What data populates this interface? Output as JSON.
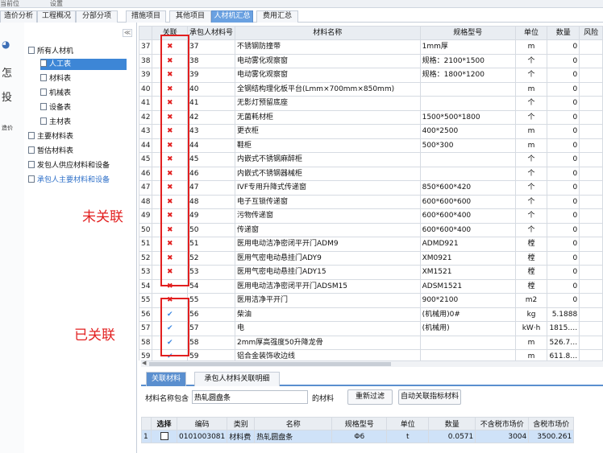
{
  "topbar": {
    "left": "当前位",
    "middle": "设置"
  },
  "tabs": [
    {
      "label": "造价分析",
      "active": false
    },
    {
      "label": "工程概况",
      "active": false
    },
    {
      "label": "分部分项",
      "active": false
    },
    {
      "label": "措施项目",
      "active": false
    },
    {
      "label": "其他项目",
      "active": false
    },
    {
      "label": "人材机汇总",
      "active": true
    },
    {
      "label": "费用汇总",
      "active": false
    }
  ],
  "left_strip": {
    "text1": "怎",
    "text2": "投",
    "text3": "造价"
  },
  "tree": {
    "collapse": "≪",
    "items": [
      {
        "label": "所有人材机",
        "level": 0,
        "selected": false
      },
      {
        "label": "人工表",
        "level": 1,
        "selected": true
      },
      {
        "label": "材料表",
        "level": 1,
        "selected": false
      },
      {
        "label": "机械表",
        "level": 1,
        "selected": false
      },
      {
        "label": "设备表",
        "level": 1,
        "selected": false
      },
      {
        "label": "主材表",
        "level": 1,
        "selected": false
      },
      {
        "label": "主要材料表",
        "level": 0,
        "selected": false
      },
      {
        "label": "暂估材料表",
        "level": 0,
        "selected": false
      },
      {
        "label": "发包人供应材料和设备",
        "level": 0,
        "selected": false
      },
      {
        "label": "承包人主要材料和设备",
        "level": 0,
        "selected": false,
        "blue": true
      }
    ]
  },
  "grid": {
    "headers": [
      "",
      "关联",
      "承包人材料号",
      "材料名称",
      "规格型号",
      "单位",
      "数量",
      "风险"
    ],
    "rows": [
      {
        "seq": "37",
        "linked": false,
        "no": "37",
        "name": "不锈钢防撞带",
        "spec": "1mm厚",
        "unit": "m",
        "qty": "0"
      },
      {
        "seq": "38",
        "linked": false,
        "no": "38",
        "name": "电动雾化观察窗",
        "spec": "规格：2100*1500",
        "unit": "个",
        "qty": "0"
      },
      {
        "seq": "39",
        "linked": false,
        "no": "39",
        "name": "电动雾化观察窗",
        "spec": "规格：1800*1200",
        "unit": "个",
        "qty": "0"
      },
      {
        "seq": "40",
        "linked": false,
        "no": "40",
        "name": "全钢结构理化板平台(Lmm×700mm×850mm)",
        "spec": "",
        "unit": "m",
        "qty": "0"
      },
      {
        "seq": "41",
        "linked": false,
        "no": "41",
        "name": "无影灯预留底座",
        "spec": "",
        "unit": "个",
        "qty": "0"
      },
      {
        "seq": "42",
        "linked": false,
        "no": "42",
        "name": "无菌耗材柜",
        "spec": "1500*500*1800",
        "unit": "个",
        "qty": "0"
      },
      {
        "seq": "43",
        "linked": false,
        "no": "43",
        "name": "更衣柜",
        "spec": "400*2500",
        "unit": "m",
        "qty": "0"
      },
      {
        "seq": "44",
        "linked": false,
        "no": "44",
        "name": "鞋柜",
        "spec": "500*300",
        "unit": "m",
        "qty": "0"
      },
      {
        "seq": "45",
        "linked": false,
        "no": "45",
        "name": "内嵌式不锈钢麻醉柜",
        "spec": "",
        "unit": "个",
        "qty": "0"
      },
      {
        "seq": "46",
        "linked": false,
        "no": "46",
        "name": "内嵌式不锈钢器械柜",
        "spec": "",
        "unit": "个",
        "qty": "0"
      },
      {
        "seq": "47",
        "linked": false,
        "no": "47",
        "name": "IVF专用升降式传递窗",
        "spec": "850*600*420",
        "unit": "个",
        "qty": "0"
      },
      {
        "seq": "48",
        "linked": false,
        "no": "48",
        "name": "电子互锁传递窗",
        "spec": "600*600*600",
        "unit": "个",
        "qty": "0"
      },
      {
        "seq": "49",
        "linked": false,
        "no": "49",
        "name": "污物传递窗",
        "spec": "600*600*400",
        "unit": "个",
        "qty": "0"
      },
      {
        "seq": "50",
        "linked": false,
        "no": "50",
        "name": "传递窗",
        "spec": "600*600*400",
        "unit": "个",
        "qty": "0"
      },
      {
        "seq": "51",
        "linked": false,
        "no": "51",
        "name": "医用电动洁净密闭平开门ADM9",
        "spec": "ADMD921",
        "unit": "樘",
        "qty": "0"
      },
      {
        "seq": "52",
        "linked": false,
        "no": "52",
        "name": "医用气密电动悬挂门ADY9",
        "spec": "XM0921",
        "unit": "樘",
        "qty": "0"
      },
      {
        "seq": "53",
        "linked": false,
        "no": "53",
        "name": "医用气密电动悬挂门ADY15",
        "spec": "XM1521",
        "unit": "樘",
        "qty": "0"
      },
      {
        "seq": "54",
        "linked": false,
        "no": "54",
        "name": "医用电动洁净密闭平开门ADSM15",
        "spec": "ADSM1521",
        "unit": "樘",
        "qty": "0"
      },
      {
        "seq": "55",
        "linked": false,
        "no": "55",
        "name": "医用洁净平开门",
        "spec": "900*2100",
        "unit": "m2",
        "qty": "0"
      },
      {
        "seq": "56",
        "linked": true,
        "no": "56",
        "name": "柴油",
        "spec": "(机械用)0#",
        "unit": "kg",
        "qty": "5.1888"
      },
      {
        "seq": "57",
        "linked": true,
        "no": "57",
        "name": "电",
        "spec": "(机械用)",
        "unit": "kW·h",
        "qty": "1815.…"
      },
      {
        "seq": "58",
        "linked": true,
        "no": "58",
        "name": "2mm厚高强度50升降龙骨",
        "spec": "",
        "unit": "m",
        "qty": "526.7…"
      },
      {
        "seq": "59",
        "linked": true,
        "no": "59",
        "name": "铝合金装饰收边线",
        "spec": "",
        "unit": "m",
        "qty": "611.8…"
      }
    ]
  },
  "annotations": {
    "unlinked": "未关联",
    "linked": "已关联"
  },
  "bottom_tabs": [
    {
      "label": "关联材料",
      "active": true
    },
    {
      "label": "承包人材料关联明细",
      "active": false
    }
  ],
  "filter": {
    "label": "材料名称包含",
    "value": "热轧圆盘条",
    "suffix": "的材料",
    "refilter": "重新过滤",
    "auto_link": "自动关联指标材料"
  },
  "grid2": {
    "headers": [
      "",
      "选择",
      "编码",
      "类别",
      "名称",
      "规格型号",
      "单位",
      "数量",
      "不含税市场价",
      "含税市场价"
    ],
    "rows": [
      {
        "seq": "1",
        "code": "0101003081",
        "category": "材料费",
        "name": "热轧圆盘条",
        "spec": "Φ6",
        "unit": "t",
        "qty": "0.0571",
        "price_ex": "3004",
        "price_in": "3500.261"
      }
    ]
  }
}
